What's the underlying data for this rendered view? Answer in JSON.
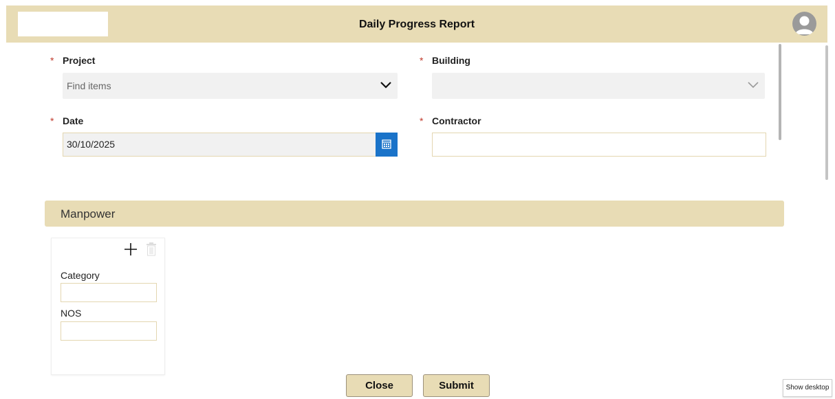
{
  "header": {
    "title": "Daily Progress Report"
  },
  "form": {
    "project": {
      "label": "Project",
      "required_mark": "*",
      "placeholder": "Find items"
    },
    "building": {
      "label": "Building",
      "required_mark": "*"
    },
    "date": {
      "label": "Date",
      "required_mark": "*",
      "value": "30/10/2025"
    },
    "contractor": {
      "label": "Contractor",
      "required_mark": "*",
      "value": ""
    }
  },
  "manpower": {
    "section_title": "Manpower",
    "category_label": "Category",
    "nos_label": "NOS"
  },
  "buttons": {
    "close": "Close",
    "submit": "Submit"
  },
  "tooltip": {
    "show_desktop": "Show desktop"
  },
  "colors": {
    "header_bg": "#e8dcb5",
    "required": "#c0392b",
    "calendar_button": "#1a73c9"
  }
}
